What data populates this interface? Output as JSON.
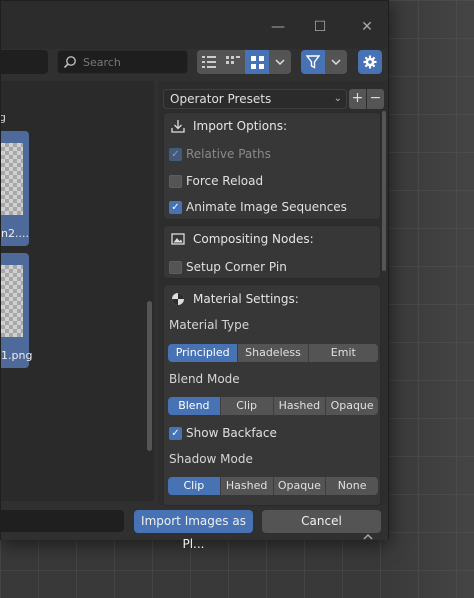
{
  "toolbar": {
    "search_placeholder": "Search"
  },
  "filelist": {
    "partial_label": "g",
    "files": [
      {
        "name": "n2...."
      },
      {
        "name": "1.png"
      }
    ]
  },
  "panel": {
    "preset_label": "Operator Presets",
    "import_options": {
      "title": "Import Options:",
      "relative_paths": "Relative Paths",
      "force_reload": "Force Reload",
      "animate_sequences": "Animate Image Sequences"
    },
    "compositing": {
      "title": "Compositing Nodes:",
      "setup_corner_pin": "Setup Corner Pin"
    },
    "material": {
      "title": "Material Settings:",
      "material_type_label": "Material Type",
      "material_types": [
        "Principled",
        "Shadeless",
        "Emit"
      ],
      "material_type_selected": "Principled",
      "blend_mode_label": "Blend Mode",
      "blend_modes": [
        "Blend",
        "Clip",
        "Hashed",
        "Opaque"
      ],
      "blend_mode_selected": "Blend",
      "show_backface": "Show Backface",
      "shadow_mode_label": "Shadow Mode",
      "shadow_modes": [
        "Clip",
        "Hashed",
        "Opaque",
        "None"
      ],
      "shadow_mode_selected": "Clip"
    }
  },
  "footer": {
    "import_button": "Import Images as Pl...",
    "cancel_button": "Cancel"
  },
  "colors": {
    "accent": "#4772b3"
  }
}
